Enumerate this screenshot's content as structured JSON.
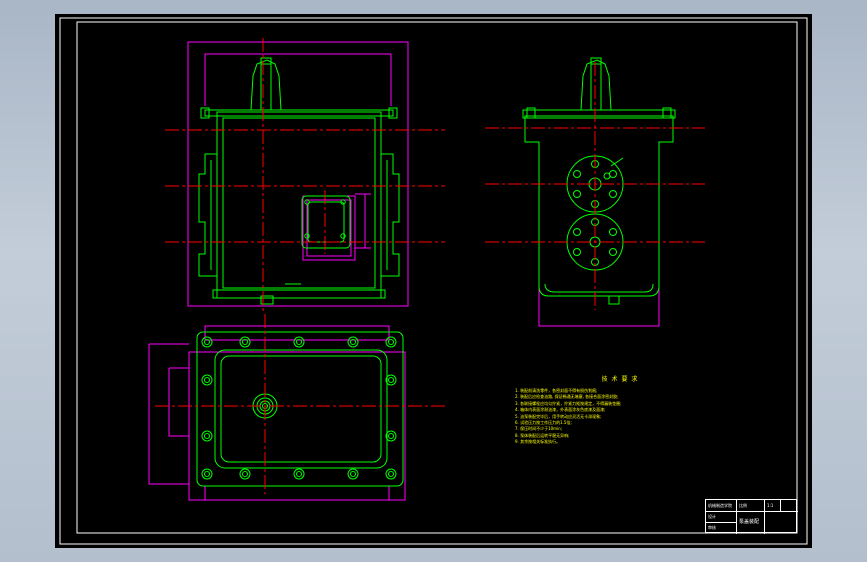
{
  "colors": {
    "background_app": "#b8c3d0",
    "sheet": "#000000",
    "outline": "#00ff00",
    "dimension": "#ff00ff",
    "centerline": "#ff0000",
    "notes_text": "#ffff00",
    "frame": "#ffffff"
  },
  "technical_notes": {
    "title": "技 术 要 求",
    "items": [
      "1. 装配前清洗零件，各密封面不得有损伤划痕;",
      "2. 装配后应检查油路, 保证畅通无堵塞, 各接合面涂密封胶;",
      "3. 各联接螺栓应均匀拧紧，拧紧力矩按规定，不得漏装垫圈;",
      "4. 箱体内表面涂耐油漆，外表面涂灰色底漆及面漆;",
      "5. 油泵装配完毕后，用手转动应灵活无卡滞现象;",
      "6. 试验压力按工作压力的1.5倍;",
      "7. 保压时间不少于10min;",
      "8. 泵体装配后运转平稳无异响;",
      "9. 其余按相关标准执行。"
    ]
  },
  "title_block": {
    "company": "机械制造学院",
    "drawing_name": "泵盖装配",
    "field_a": "比例",
    "field_b": "1:1",
    "designer": "设计",
    "checker": "审核"
  }
}
